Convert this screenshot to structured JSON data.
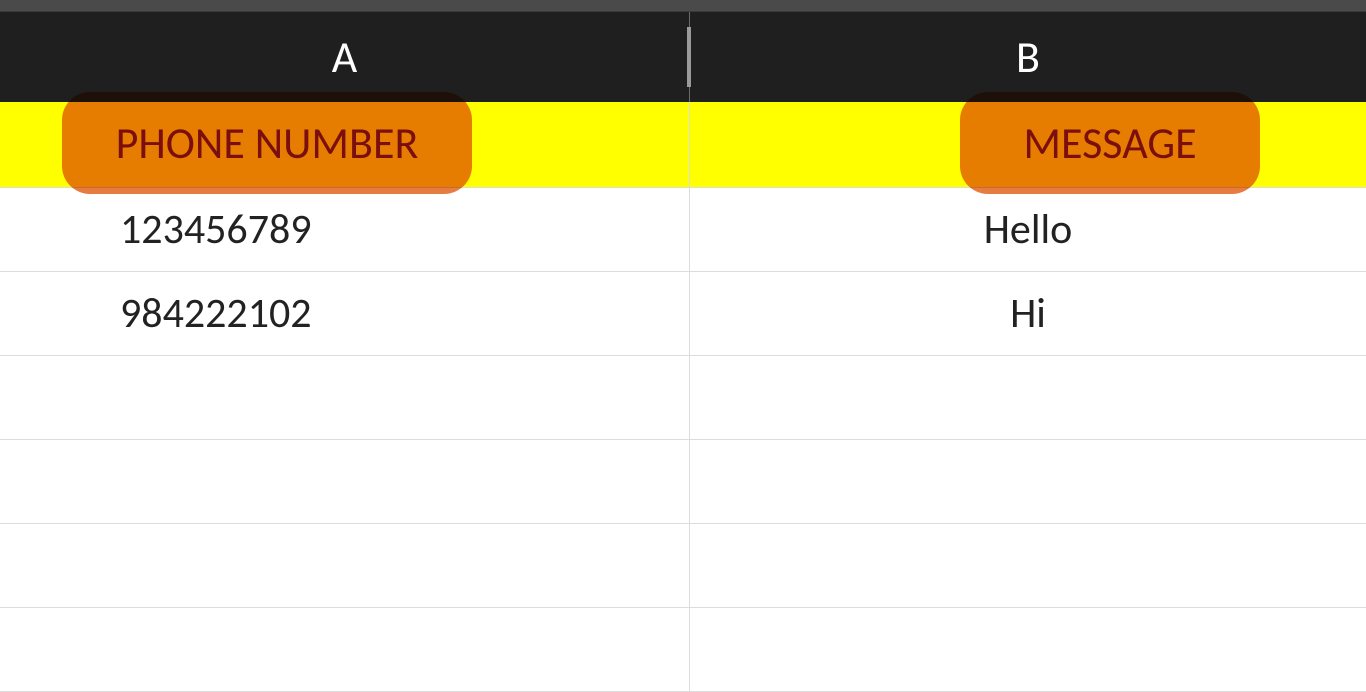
{
  "columns": {
    "a": "A",
    "b": "B"
  },
  "headers": {
    "phone": "PHONE NUMBER",
    "message": "MESSAGE"
  },
  "rows": [
    {
      "phone": "123456789",
      "message": "Hello"
    },
    {
      "phone": "984222102",
      "message": "Hi"
    }
  ]
}
